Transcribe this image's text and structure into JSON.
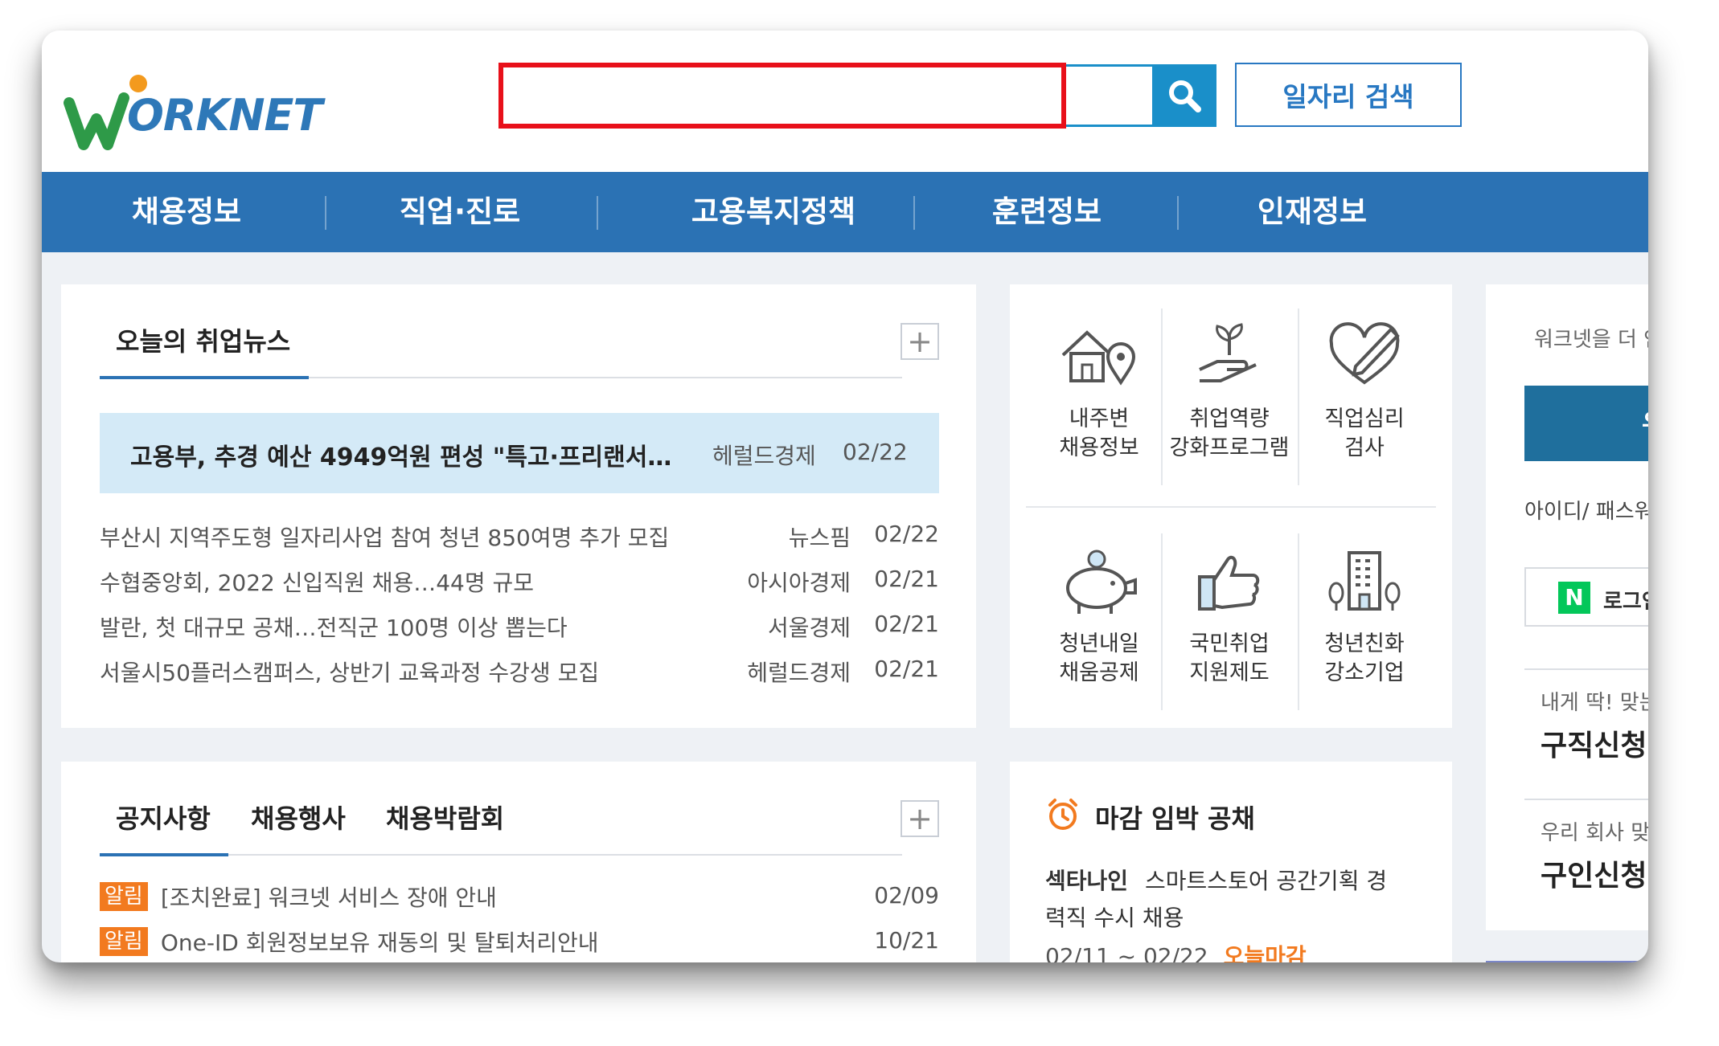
{
  "header": {
    "logo_text": "ORKNET",
    "search": {
      "placeholder": "",
      "value": ""
    },
    "job_search_label": "일자리 검색"
  },
  "nav": [
    {
      "label": "채용정보"
    },
    {
      "label": "직업·진로"
    },
    {
      "label": "고용복지정책"
    },
    {
      "label": "훈련정보"
    },
    {
      "label": "인재정보"
    }
  ],
  "news": {
    "title": "오늘의 취업뉴스",
    "headline": {
      "title": "고용부, 추경 예산 4949억원 편성 \"특고·프리랜서…",
      "source": "헤럴드경제",
      "date": "02/22"
    },
    "items": [
      {
        "title": "부산시 지역주도형 일자리사업 참여 청년 850여명 추가 모집",
        "source": "뉴스핌",
        "date": "02/22"
      },
      {
        "title": "수협중앙회, 2022 신입직원 채용…44명 규모",
        "source": "아시아경제",
        "date": "02/21"
      },
      {
        "title": "발란, 첫 대규모 공채…전직군 100명 이상 뽑는다",
        "source": "서울경제",
        "date": "02/21"
      },
      {
        "title": "서울시50플러스캠퍼스, 상반기 교육과정 수강생 모집",
        "source": "헤럴드경제",
        "date": "02/21"
      }
    ]
  },
  "services": [
    {
      "label1": "내주변",
      "label2": "채용정보",
      "icon": "house-location-icon"
    },
    {
      "label1": "취업역량",
      "label2": "강화프로그램",
      "icon": "plant-hand-icon"
    },
    {
      "label1": "직업심리",
      "label2": "검사",
      "icon": "heart-pen-icon"
    },
    {
      "label1": "청년내일",
      "label2": "채움공제",
      "icon": "piggy-bank-icon"
    },
    {
      "label1": "국민취업",
      "label2": "지원제도",
      "icon": "thumbs-up-icon"
    },
    {
      "label1": "청년친화",
      "label2": "강소기업",
      "icon": "building-icon"
    }
  ],
  "notices": {
    "tabs": [
      {
        "label": "공지사항"
      },
      {
        "label": "채용행사"
      },
      {
        "label": "채용박람회"
      }
    ],
    "items": [
      {
        "badge": "알림",
        "title": "[조치완료] 워크넷 서비스 장애 안내",
        "date": "02/09"
      },
      {
        "badge": "알림",
        "title": "One-ID 회원정보보유 재동의 및 탈퇴처리안내",
        "date": "10/21"
      }
    ]
  },
  "deadline": {
    "title": "마감 임박 공채",
    "company": "섹타나인",
    "job_line1": "스마트스토어 공간기획 경",
    "job_line2": "력직 수시 채용",
    "period": "02/11 ~ 02/22",
    "status": "오늘마감"
  },
  "side": {
    "intro": "워크넷을 더 안",
    "login_button": "우",
    "id_pw": "아이디/ 패스워",
    "naver_badge": "N",
    "naver_login": "로그인",
    "seek_sub": "내게 딱! 맞는",
    "seek_title": "구직신청",
    "hire_sub": "우리 회사 맞",
    "hire_title": "구인신청"
  },
  "colors": {
    "brand_blue": "#2b72b4",
    "search_blue": "#1a8fc9",
    "highlight_red": "#e8101a",
    "alert_orange": "#f27a1f",
    "naver_green": "#03c75a"
  }
}
